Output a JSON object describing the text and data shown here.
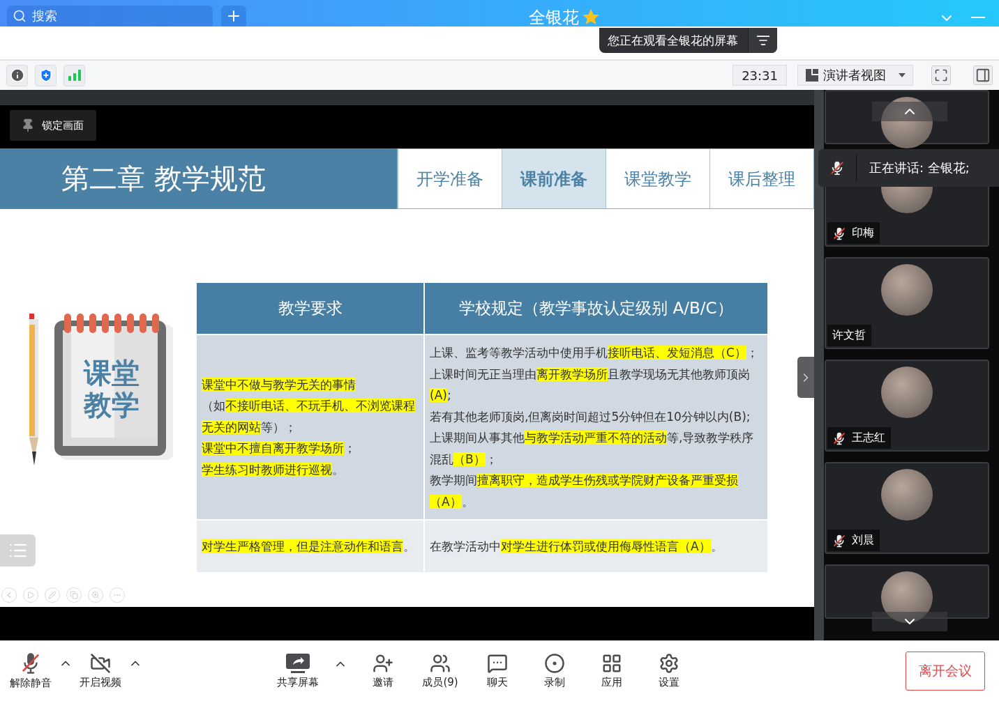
{
  "top_bar": {
    "search": {
      "placeholder": "搜索"
    },
    "title": "全银花"
  },
  "share_banner": {
    "text": "您正在观看全银花的屏幕"
  },
  "toolbar": {
    "time": "23:31",
    "view_mode": "演讲者视图"
  },
  "share": {
    "lock_button": "锁定画面",
    "slide": {
      "title": "第二章 教学规范",
      "tabs": [
        {
          "label": "开学准备",
          "selected": false
        },
        {
          "label": "课前准备",
          "selected": true
        },
        {
          "label": "课堂教学",
          "selected": false
        },
        {
          "label": "课后整理",
          "selected": false
        }
      ],
      "badge_lines": [
        "课堂",
        "教学"
      ],
      "table": {
        "columns": [
          "教学要求",
          "学校规定（教学事故认定级别 A/B/C）"
        ],
        "rows": [
          [
            [
              [
                {
                  "text": "课堂中不做与教学无关的事情",
                  "highlighted": true
                }
              ],
              [
                {
                  "text": "（如",
                  "highlighted": false
                },
                {
                  "text": "不接听电话、不玩手机、不浏览课程无关的网站",
                  "highlighted": true
                },
                {
                  "text": "等）；",
                  "highlighted": false
                }
              ],
              [
                {
                  "text": "课堂中不擅自离开教学场所",
                  "highlighted": true
                },
                {
                  "text": "；",
                  "highlighted": false
                }
              ],
              [
                {
                  "text": "学生练习时教师进行巡视",
                  "highlighted": true
                },
                {
                  "text": "。",
                  "highlighted": false
                }
              ]
            ],
            [
              [
                {
                  "text": "上课、监考等教学活动中使用手机",
                  "highlighted": false
                },
                {
                  "text": "接听电话、发短消息（C）",
                  "highlighted": true
                },
                {
                  "text": "；",
                  "highlighted": false
                }
              ],
              [
                {
                  "text": "上课时间无正当理由",
                  "highlighted": false
                },
                {
                  "text": "离开教学场所",
                  "highlighted": true
                },
                {
                  "text": "且教学现场无其他教师顶岗",
                  "highlighted": false
                },
                {
                  "text": "(A)",
                  "highlighted": true
                },
                {
                  "text": ";",
                  "highlighted": false
                }
              ],
              [
                {
                  "text": "若有其他老师顶岗,但离岗时间超过5分钟但在10分钟以内(B);",
                  "highlighted": false
                }
              ],
              [
                {
                  "text": "上课期间从事其他",
                  "highlighted": false
                },
                {
                  "text": "与教学活动严重不符的活动",
                  "highlighted": true
                },
                {
                  "text": "等,导致教学秩序混乱",
                  "highlighted": false
                },
                {
                  "text": "（B）",
                  "highlighted": true
                },
                {
                  "text": "；",
                  "highlighted": false
                }
              ],
              [
                {
                  "text": "教学期间",
                  "highlighted": false
                },
                {
                  "text": "擅离职守，造成学生伤残或学院财产设备严重受损（A）",
                  "highlighted": true
                },
                {
                  "text": "。",
                  "highlighted": false
                }
              ]
            ]
          ],
          [
            [
              [
                {
                  "text": "对学生严格管理，但是注意动作和语言",
                  "highlighted": true
                },
                {
                  "text": "。",
                  "highlighted": false
                }
              ]
            ],
            [
              [
                {
                  "text": "在教学活动中",
                  "highlighted": false
                },
                {
                  "text": "对学生进行体罚或使用侮辱性语言（A）",
                  "highlighted": true
                },
                {
                  "text": "。",
                  "highlighted": false
                }
              ]
            ]
          ]
        ]
      }
    }
  },
  "speaking": {
    "text": "正在讲话: 全银花;",
    "muted": true
  },
  "participants": [
    {
      "kind": "partial"
    },
    {
      "kind": "tile",
      "name": "印梅",
      "muted": true
    },
    {
      "kind": "tile",
      "name": "许文哲",
      "muted": false
    },
    {
      "kind": "tile",
      "name": "王志红",
      "muted": true
    },
    {
      "kind": "tile",
      "name": "刘晨",
      "muted": true
    },
    {
      "kind": "partial"
    }
  ],
  "bottom_bar": {
    "items": [
      {
        "kind": "unmute",
        "label": "解除静音",
        "menu": true
      },
      {
        "kind": "video",
        "label": "开启视频",
        "menu": true
      },
      {
        "kind": "share",
        "label": "共享屏幕",
        "menu": true
      },
      {
        "kind": "invite",
        "label": "邀请",
        "menu": false
      },
      {
        "kind": "members",
        "label": "成员(9)",
        "menu": false
      },
      {
        "kind": "chat",
        "label": "聊天",
        "menu": false
      },
      {
        "kind": "record",
        "label": "录制",
        "menu": false
      },
      {
        "kind": "apps",
        "label": "应用",
        "menu": false
      },
      {
        "kind": "settings",
        "label": "设置",
        "menu": false
      }
    ],
    "leave": "离开会议"
  }
}
